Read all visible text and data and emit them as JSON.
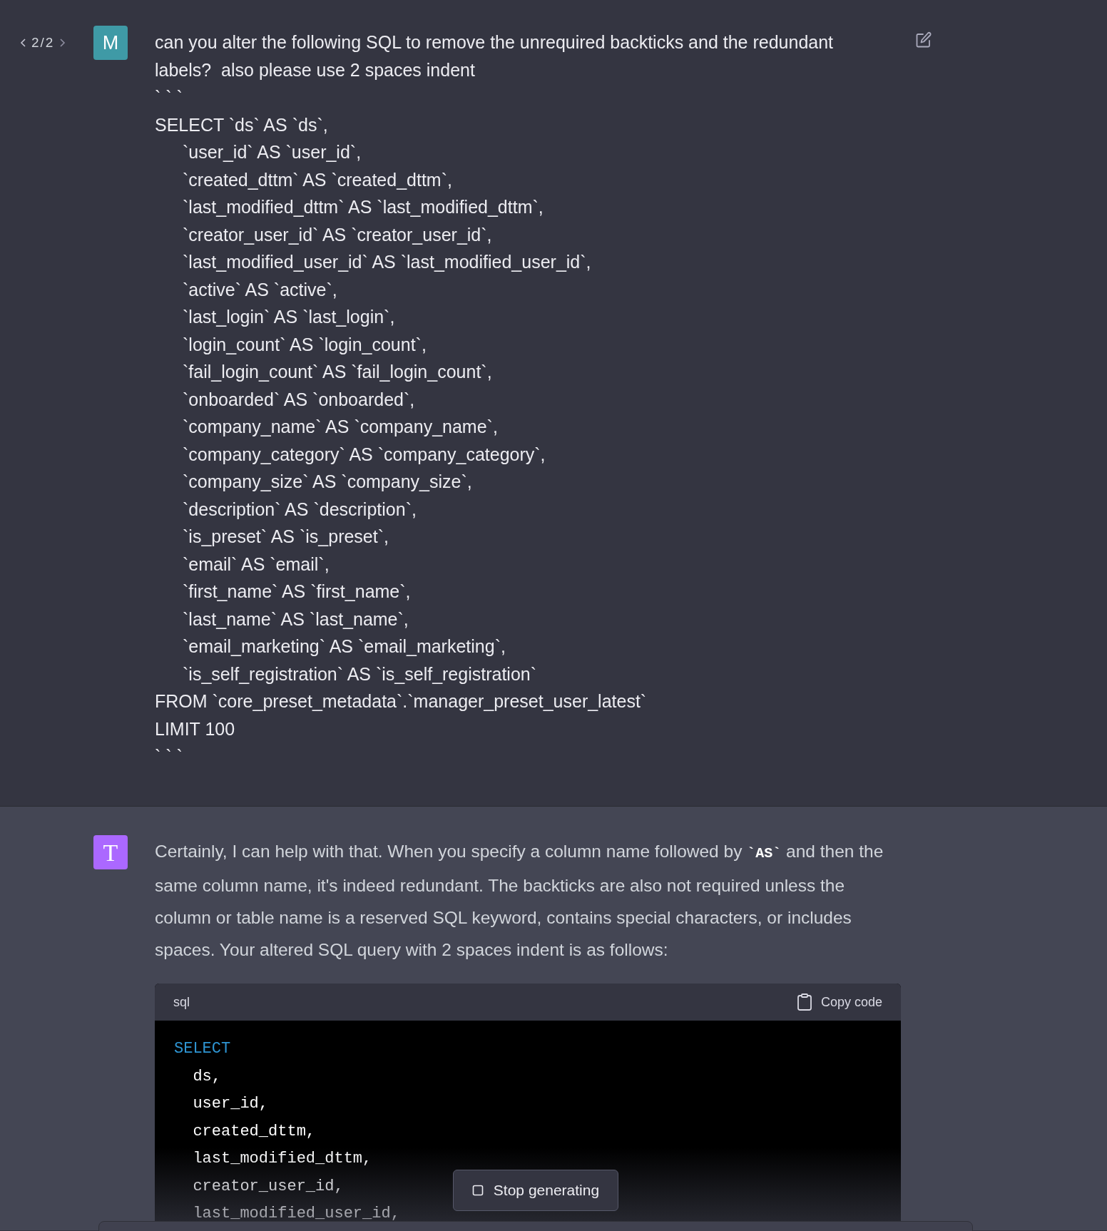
{
  "user_message": {
    "nav": {
      "counter": "2/2"
    },
    "avatar": {
      "letter": "M",
      "color": "#3f9aa6"
    },
    "lines": [
      {
        "text": "can you alter the following SQL to remove the unrequired backticks and the redundant",
        "indent": false
      },
      {
        "text": "labels?  also please use 2 spaces indent",
        "indent": false
      },
      {
        "text": "` ` `",
        "indent": false
      },
      {
        "text": "SELECT `ds` AS `ds`,",
        "indent": false
      },
      {
        "text": "`user_id` AS `user_id`,",
        "indent": true
      },
      {
        "text": "`created_dttm` AS `created_dttm`,",
        "indent": true
      },
      {
        "text": "`last_modified_dttm` AS `last_modified_dttm`,",
        "indent": true
      },
      {
        "text": "`creator_user_id` AS `creator_user_id`,",
        "indent": true
      },
      {
        "text": "`last_modified_user_id` AS `last_modified_user_id`,",
        "indent": true
      },
      {
        "text": "`active` AS `active`,",
        "indent": true
      },
      {
        "text": "`last_login` AS `last_login`,",
        "indent": true
      },
      {
        "text": "`login_count` AS `login_count`,",
        "indent": true
      },
      {
        "text": "`fail_login_count` AS `fail_login_count`,",
        "indent": true
      },
      {
        "text": "`onboarded` AS `onboarded`,",
        "indent": true
      },
      {
        "text": "`company_name` AS `company_name`,",
        "indent": true
      },
      {
        "text": "`company_category` AS `company_category`,",
        "indent": true
      },
      {
        "text": "`company_size` AS `company_size`,",
        "indent": true
      },
      {
        "text": "`description` AS `description`,",
        "indent": true
      },
      {
        "text": "`is_preset` AS `is_preset`,",
        "indent": true
      },
      {
        "text": "`email` AS `email`,",
        "indent": true
      },
      {
        "text": "`first_name` AS `first_name`,",
        "indent": true
      },
      {
        "text": "`last_name` AS `last_name`,",
        "indent": true
      },
      {
        "text": "`email_marketing` AS `email_marketing`,",
        "indent": true
      },
      {
        "text": "`is_self_registration` AS `is_self_registration`",
        "indent": true
      },
      {
        "text": "FROM `core_preset_metadata`.`manager_preset_user_latest`",
        "indent": false
      },
      {
        "text": "LIMIT 100",
        "indent": false
      },
      {
        "text": "` ` `",
        "indent": false
      }
    ]
  },
  "assistant_message": {
    "avatar": {
      "letter": "T",
      "color": "#ab68ff"
    },
    "paragraph": [
      {
        "kind": "text",
        "text": "Certainly, I can help with that. When you specify a column name followed by "
      },
      {
        "kind": "code",
        "text": "`AS`"
      },
      {
        "kind": "text",
        "text": " and then the same column name, it's indeed redundant. The backticks are also not required unless the column or table name is a reserved SQL keyword, contains special characters, or includes spaces. Your altered SQL query with 2 spaces indent is as follows:"
      }
    ],
    "code_block": {
      "language": "sql",
      "copy_label": "Copy code",
      "lines": [
        {
          "kind": "keyword",
          "text": "SELECT"
        },
        {
          "kind": "plain",
          "text": "  ds,"
        },
        {
          "kind": "plain",
          "text": "  user_id,"
        },
        {
          "kind": "plain",
          "text": "  created_dttm,"
        },
        {
          "kind": "plain",
          "text": "  last_modified_dttm,"
        },
        {
          "kind": "plain",
          "text": "  creator_user_id,"
        },
        {
          "kind": "plain",
          "text": "  last_modified_user_id,"
        }
      ]
    }
  },
  "stop_button": {
    "label": "Stop generating"
  }
}
